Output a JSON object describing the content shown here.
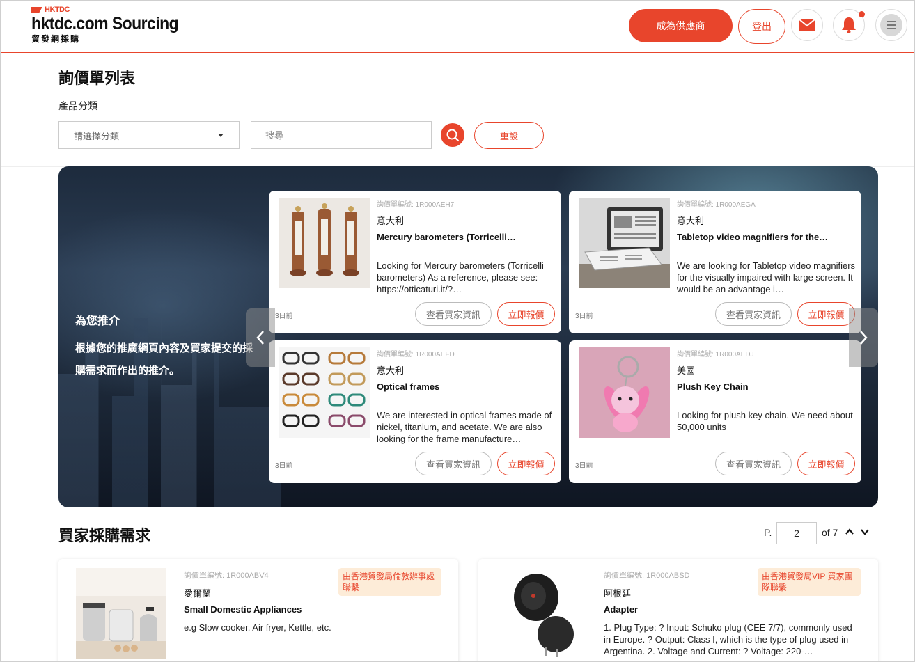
{
  "header": {
    "logo_mark": "HKTDC",
    "logo_name": "hktdc.com Sourcing",
    "logo_sub": "貿發網採購",
    "become_supplier": "成為供應商",
    "logout": "登出"
  },
  "filter": {
    "page_title": "詢價單列表",
    "category_label": "產品分類",
    "category_placeholder": "請選擇分類",
    "search_placeholder": "搜尋",
    "reset": "重設"
  },
  "recommend": {
    "heading": "為您推介",
    "description": "根據您的推廣網頁內容及買家提交的採購需求而作出的推介。",
    "cards": [
      {
        "ref": "詢價單編號: 1R000AEH7",
        "country": "意大利",
        "title": "Mercury barometers (Torricelli…",
        "desc": "Looking for Mercury barometers (Torricelli barometers) As a reference, please see: https://otticaturi.it/?…",
        "age": "3日前",
        "view": "查看買家資訊",
        "quote": "立即報價"
      },
      {
        "ref": "詢價單編號: 1R000AEGA",
        "country": "意大利",
        "title": "Tabletop video magnifiers for the…",
        "desc": "We are looking for Tabletop video magnifiers for the visually impaired with large screen. It would be an advantage i…",
        "age": "3日前",
        "view": "查看買家資訊",
        "quote": "立即報價"
      },
      {
        "ref": "詢價單編號: 1R000AEFD",
        "country": "意大利",
        "title": "Optical frames",
        "desc": "We are interested in optical frames made of nickel, titanium, and acetate. We are also looking for the frame manufacture…",
        "age": "3日前",
        "view": "查看買家資訊",
        "quote": "立即報價"
      },
      {
        "ref": "詢價單編號: 1R000AEDJ",
        "country": "美國",
        "title": "Plush Key Chain",
        "desc": "Looking for plush key chain. We need about 50,000 units",
        "age": "3日前",
        "view": "查看買家資訊",
        "quote": "立即報價"
      }
    ]
  },
  "requests": {
    "title": "買家採購需求",
    "pager": {
      "prefix": "P.",
      "current": "2",
      "of": "of 7"
    },
    "items": [
      {
        "ref": "詢價單編號: 1R000ABV4",
        "badge": "由香港貿發局倫敦辦事處聯繫",
        "country": "愛爾蘭",
        "title": "Small Domestic Appliances",
        "desc": "e.g Slow cooker, Air fryer, Kettle, etc."
      },
      {
        "ref": "詢價單編號: 1R000ABSD",
        "badge": "由香港貿發局VIP 買家團隊聯繫",
        "country": "阿根廷",
        "title": "Adapter",
        "desc": "1. Plug Type: ? Input: Schuko plug (CEE 7/7), commonly used in Europe. ? Output: Class I, which is the type of plug used in Argentina. 2. Voltage and Current: ? Voltage: 220-…"
      }
    ]
  },
  "colors": {
    "accent": "#e8452c",
    "badge_bg": "#fdecd8"
  },
  "icons": [
    "mail-icon",
    "bell-icon",
    "menu-icon",
    "search-icon",
    "chevron-left-icon",
    "chevron-right-icon",
    "chevron-up-icon",
    "chevron-down-icon",
    "dropdown-caret-icon"
  ]
}
